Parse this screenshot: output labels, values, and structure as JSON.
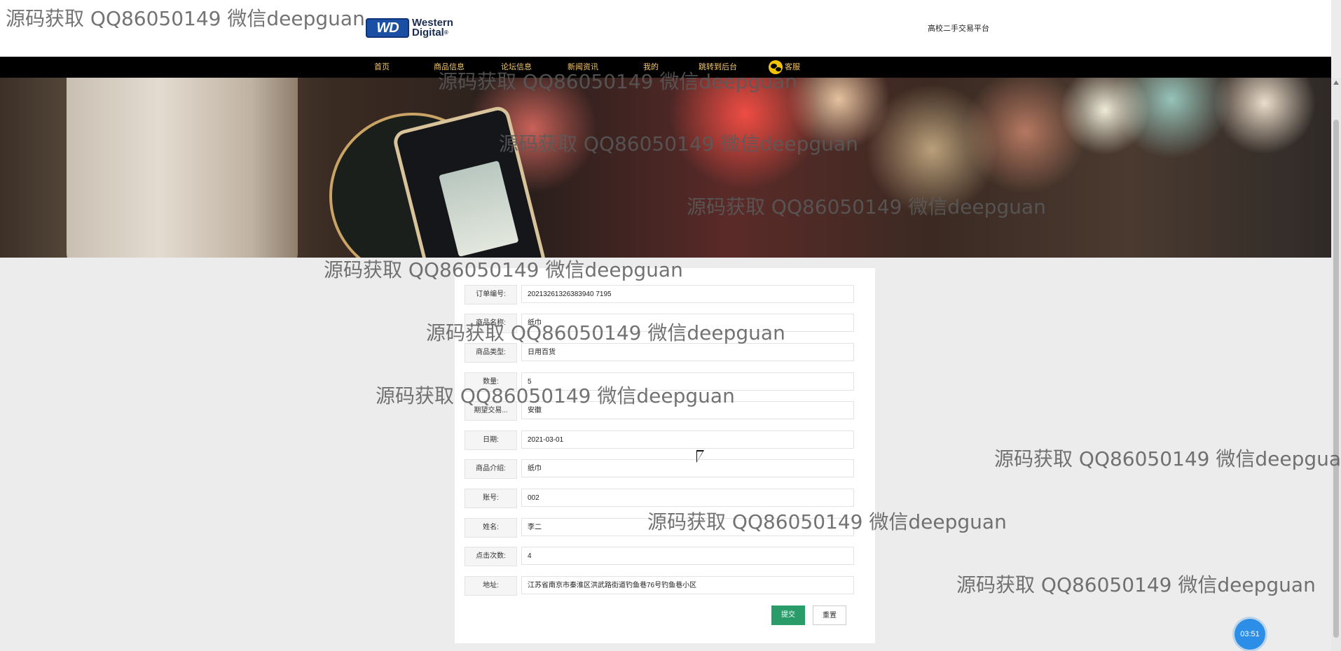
{
  "header": {
    "logo_badge": "WD",
    "logo_line1": "Western",
    "logo_line2": "Digital",
    "logo_mark": "®",
    "site_title": "高校二手交易平台"
  },
  "nav": {
    "items": [
      {
        "label": "首页"
      },
      {
        "label": "商品信息"
      },
      {
        "label": "论坛信息"
      },
      {
        "label": "新闻资讯"
      },
      {
        "label": "我的"
      },
      {
        "label": "跳转到后台"
      },
      {
        "label": "客服"
      }
    ]
  },
  "form": {
    "rows": [
      {
        "label": "订单编号:",
        "value": "20213261326383940 7195"
      },
      {
        "label": "商品名称:",
        "value": "纸巾"
      },
      {
        "label": "商品类型:",
        "value": "日用百货"
      },
      {
        "label": "数量:",
        "value": "5"
      },
      {
        "label": "期望交易...",
        "value": "安徽"
      },
      {
        "label": "日期:",
        "value": "2021-03-01"
      },
      {
        "label": "商品介绍:",
        "value": "纸巾"
      },
      {
        "label": "账号:",
        "value": "002"
      },
      {
        "label": "姓名:",
        "value": "李二"
      },
      {
        "label": "点击次数:",
        "value": "4"
      },
      {
        "label": "地址:",
        "value": "江苏省南京市秦淮区洪武路街道钓鱼巷76号钓鱼巷小区"
      }
    ],
    "submit_label": "提交",
    "reset_label": "重置"
  },
  "timer": "03:51",
  "watermark_text": "源码获取 QQ86050149 微信deepguan",
  "colors": {
    "nav_bg": "#000000",
    "nav_text": "#f2c86a",
    "submit_bg": "#2a9c6a",
    "timer_bg": "#2d8ee8",
    "page_bg": "#ececec"
  }
}
